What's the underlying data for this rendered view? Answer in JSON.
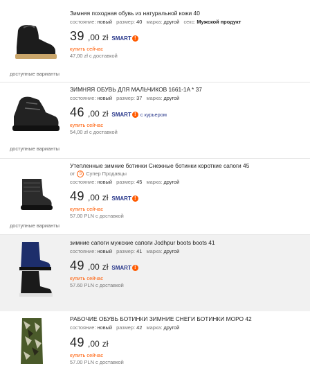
{
  "labels": {
    "state": "состояние:",
    "size": "размер:",
    "brand": "марка:",
    "sex": "секс:",
    "buy_now": "купить сейчас",
    "variants": "доступные варианты",
    "smart": "SMART",
    "from": "от"
  },
  "items": [
    {
      "title": "Зимняя походная обувь из натуральной кожи 40",
      "state": "новый",
      "size": "40",
      "brand": "другой",
      "sex": "Мужской продукт",
      "price_int": "39",
      "price_dec": ",00",
      "currency": "zł",
      "delivery": "47,00 zł с доставкой"
    },
    {
      "title": "ЗИМНЯЯ ОБУВЬ ДЛЯ МАЛЬЧИКОВ 1661-1A * 37",
      "state": "новый",
      "size": "37",
      "brand": "другой",
      "price_int": "46",
      "price_dec": ",00",
      "currency": "zł",
      "courier": "с курьером",
      "delivery": "54,00 zł с доставкой"
    },
    {
      "title": "Утепленные зимние ботинки Снежные ботинки короткие сапоги 45",
      "seller": "Супер Продавцы",
      "state": "новый",
      "size": "45",
      "brand": "другой",
      "price_int": "49",
      "price_dec": ",00",
      "currency": "zł",
      "delivery": "57.00 PLN с доставкой"
    },
    {
      "title": "зимние сапоги мужские сапоги Jodhpur boots boots 41",
      "state": "новый",
      "size": "41",
      "brand": "другой",
      "price_int": "49",
      "price_dec": ",00",
      "currency": "zł",
      "delivery": "57.60 PLN с доставкой"
    },
    {
      "title": "РАБОЧИЕ ОБУВЬ БОТИНКИ ЗИМНИЕ СНЕГИ БОТИНКИ МОРО 42",
      "state": "новый",
      "size": "42",
      "brand": "другой",
      "price_int": "49",
      "price_dec": ",00",
      "currency": "zł",
      "delivery": "57.00 PLN с доставкой"
    }
  ]
}
